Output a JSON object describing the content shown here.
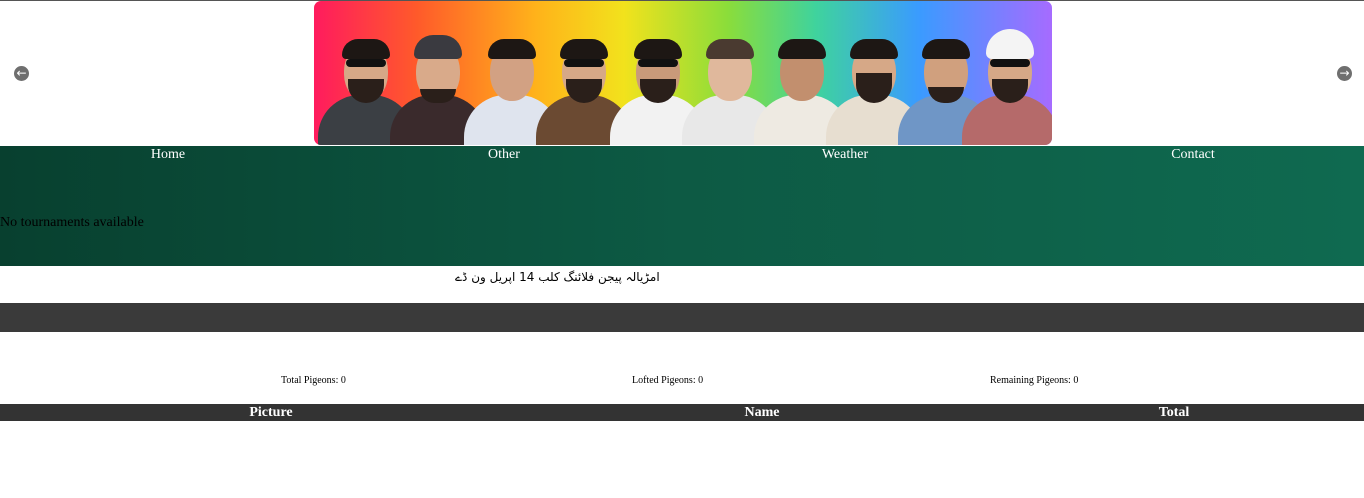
{
  "banner": {
    "prev_arrow": "←",
    "next_arrow": "→"
  },
  "nav": {
    "items": [
      {
        "label": "Home"
      },
      {
        "label": "Other"
      },
      {
        "label": "Weather"
      },
      {
        "label": "Contact"
      }
    ]
  },
  "tournaments": {
    "empty_message": "No tournaments available"
  },
  "event": {
    "title": "امڑیالہ پیجن فلائنگ کلب 14 اپریل ون ڈے"
  },
  "stats": {
    "total_label": "Total Pigeons: 0",
    "lofted_label": "Lofted Pigeons: 0",
    "remaining_label": "Remaining Pigeons: 0"
  },
  "table": {
    "columns": [
      "Picture",
      "Name",
      "Total"
    ]
  },
  "colors": {
    "nav_start": "#08402f",
    "nav_end": "#0f6a50",
    "dark_bar": "#3a3a3a",
    "table_header": "#333333"
  }
}
